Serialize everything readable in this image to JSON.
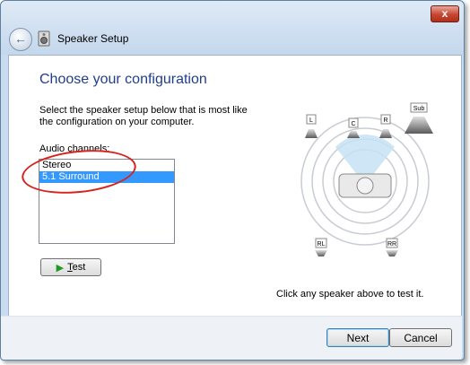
{
  "window": {
    "title": "Speaker Setup",
    "close_label": "x"
  },
  "page": {
    "heading": "Choose your configuration",
    "description": "Select the speaker setup below that is most like the configuration on your computer."
  },
  "channels": {
    "label": "Audio channels:",
    "items": [
      "Stereo",
      "5.1 Surround"
    ],
    "selected": "5.1 Surround"
  },
  "test_button": {
    "accel": "T",
    "rest": "est"
  },
  "hint": "Click any speaker above to test it.",
  "speakers": {
    "left": "L",
    "center": "C",
    "right": "R",
    "sub": "Sub",
    "rear_left": "RL",
    "rear_right": "RR"
  },
  "footer": {
    "next_label": "Next",
    "cancel_label": "Cancel"
  },
  "colors": {
    "heading": "#1f3e8c",
    "selection": "#3399ff",
    "annotation": "#d8221c",
    "play_arrow": "#1f9a1f"
  }
}
